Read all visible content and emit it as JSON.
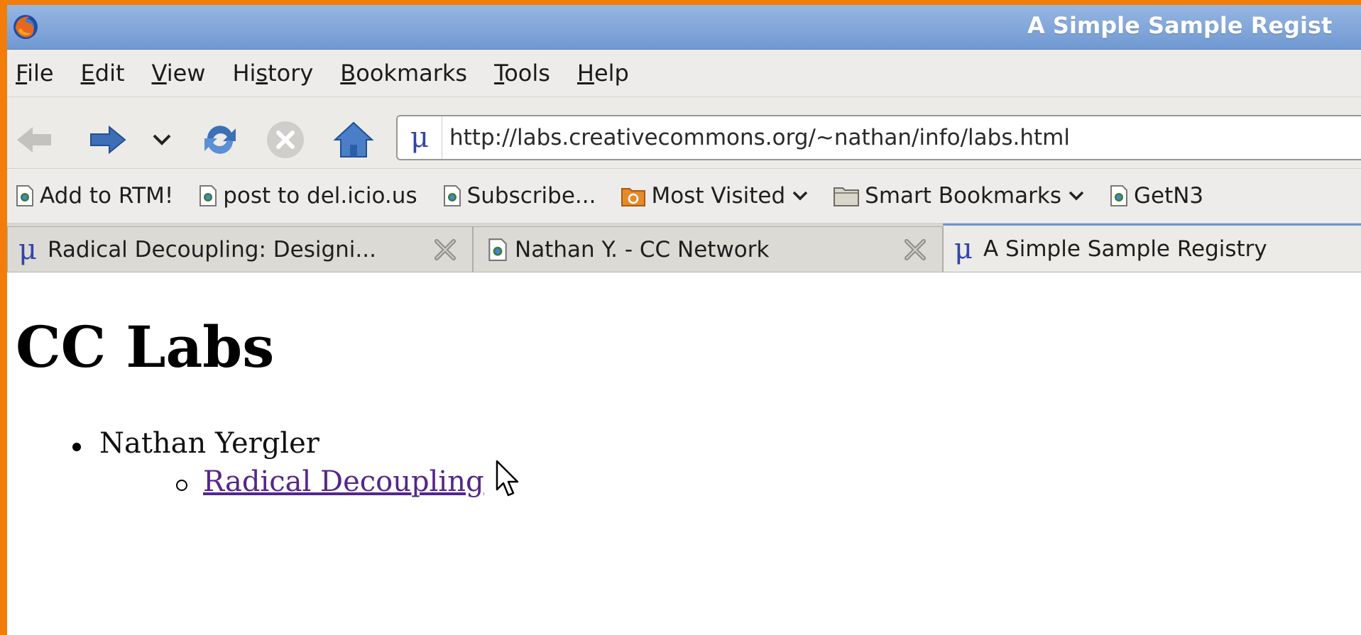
{
  "window": {
    "title": "A Simple Sample Regist"
  },
  "menu": {
    "items": [
      {
        "label_pre": "",
        "label_key": "F",
        "label_post": "ile"
      },
      {
        "label_pre": "",
        "label_key": "E",
        "label_post": "dit"
      },
      {
        "label_pre": "",
        "label_key": "V",
        "label_post": "iew"
      },
      {
        "label_pre": "Hi",
        "label_key": "s",
        "label_post": "tory"
      },
      {
        "label_pre": "",
        "label_key": "B",
        "label_post": "ookmarks"
      },
      {
        "label_pre": "",
        "label_key": "T",
        "label_post": "ools"
      },
      {
        "label_pre": "",
        "label_key": "H",
        "label_post": "elp"
      }
    ]
  },
  "navbar": {
    "url": "http://labs.creativecommons.org/~nathan/info/labs.html",
    "url_favicon": "μ"
  },
  "bookmarks": {
    "items": [
      {
        "label": "Add to RTM!"
      },
      {
        "label": "post to del.icio.us"
      },
      {
        "label": "Subscribe..."
      },
      {
        "label": "Most Visited"
      },
      {
        "label": "Smart Bookmarks"
      },
      {
        "label": "GetN3"
      }
    ]
  },
  "tabs": {
    "items": [
      {
        "label": "Radical Decoupling: Designi...",
        "favicon": "μ"
      },
      {
        "label": "Nathan Y. - CC Network"
      },
      {
        "label": "A Simple Sample Registry",
        "favicon": "μ"
      }
    ]
  },
  "page": {
    "heading": "CC Labs",
    "person": "Nathan Yergler",
    "link": "Radical Decoupling"
  },
  "colors": {
    "desktop_bg": "#f37d0b",
    "titlebar": "#7099d2",
    "visited_link": "#55268b",
    "nav_icon_blue": "#3d6fb6"
  }
}
